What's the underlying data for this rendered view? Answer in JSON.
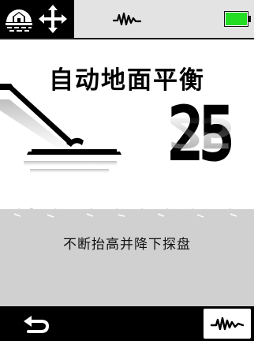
{
  "status_bar": {
    "icons": [
      "ground-balance-icon",
      "pinpoint-icon",
      "signal-wave-icon",
      "battery-icon"
    ],
    "battery_level": 1.0,
    "battery_color": "#22dd22"
  },
  "main": {
    "title": "自动地面平衡",
    "ground_balance_value": "25",
    "instruction": "不断抬高并降下探盘"
  },
  "bottom_bar": {
    "icons": [
      "back-arrow-icon",
      "signal-wave-icon"
    ]
  },
  "colors": {
    "status_bar_bg": "#e3e3e3",
    "soil": "#d0d0d0",
    "bar_bg": "#000000"
  }
}
